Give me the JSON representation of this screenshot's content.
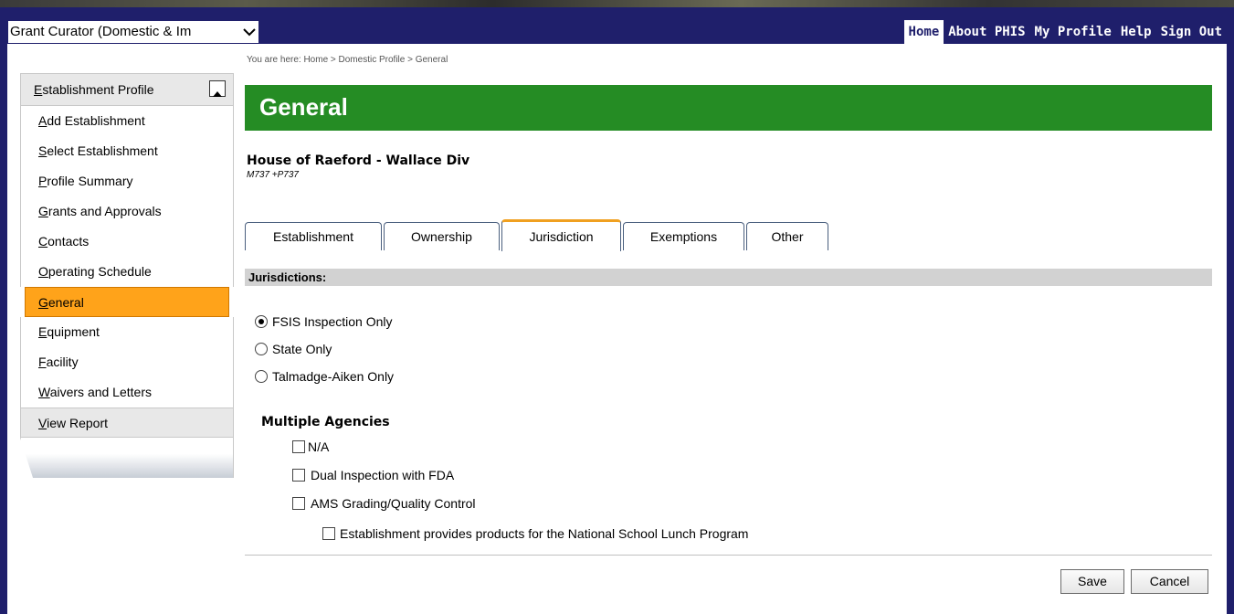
{
  "header": {
    "role_select_value": "Grant Curator (Domestic & Im",
    "nav": [
      "Home",
      "About PHIS",
      "My Profile",
      "Help",
      "Sign Out"
    ]
  },
  "sidebar": {
    "header": "Establishment Profile",
    "items": [
      "Add Establishment",
      "Select Establishment",
      "Profile Summary",
      "Grants and Approvals",
      "Contacts",
      "Operating Schedule",
      "General",
      "Equipment",
      "Facility",
      "Waivers and Letters"
    ],
    "active_item": "General",
    "report": "View Report"
  },
  "breadcrumb": "You are here: Home > Domestic Profile > General",
  "page": {
    "title": "General",
    "establishment_name": "House of Raeford - Wallace Div",
    "establishment_code": "M737 +P737"
  },
  "tabs": [
    "Establishment",
    "Ownership",
    "Jurisdiction",
    "Exemptions",
    "Other"
  ],
  "active_tab": "Jurisdiction",
  "section": {
    "title": "Jurisdictions:"
  },
  "jurisdiction_options": [
    {
      "label": "FSIS Inspection Only",
      "checked": true
    },
    {
      "label": "State Only",
      "checked": false
    },
    {
      "label": "Talmadge-Aiken Only",
      "checked": false
    }
  ],
  "multiple_agencies": {
    "heading": "Multiple Agencies",
    "options": [
      {
        "label": "N/A",
        "checked": false
      },
      {
        "label": "Dual Inspection with FDA",
        "checked": false
      },
      {
        "label": "AMS Grading/Quality Control",
        "checked": false
      },
      {
        "label": "Establishment provides products for the National School Lunch Program",
        "checked": false
      }
    ]
  },
  "buttons": {
    "save": "Save",
    "cancel": "Cancel"
  },
  "colors": {
    "nav_bg": "#1f1f6b",
    "title_green": "#258c24",
    "active_orange": "#ffa31a",
    "tab_accent": "#f0a020"
  }
}
